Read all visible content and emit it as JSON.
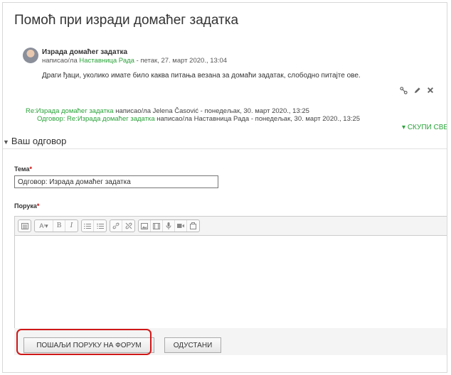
{
  "page": {
    "title": "Помоћ при изради домаћег задатка"
  },
  "post": {
    "subject": "Израда домаћег задатка",
    "by_prefix": "написао/ла ",
    "author": "Наставница Рада",
    "by_suffix": " - петак, 27. март 2020., 13:04",
    "body": "Драги ђаци, уколико имате било каква питања везана за домаћи задатак, слободно питајте ове.",
    "actions": [
      "permalink-icon",
      "edit-icon",
      "delete-icon"
    ]
  },
  "thread": [
    {
      "link": "Re:Израда домаћег задатка",
      "text": " написао/ла Jelena Časović - понедељак, 30. март 2020., 13:25"
    },
    {
      "link": "Одговор: Re:Израда домаћег задатка",
      "text": " написао/ла Наставница Рада - понедељак, 30. март 2020., 13:25"
    }
  ],
  "collapse_all": "СКУПИ СВЕ",
  "form": {
    "section_title": "Ваш одговор",
    "subject_label": "Тема",
    "subject_value": "Одговор: Израда домаћег задатка",
    "message_label": "Порука",
    "required_mark": "*",
    "toolbar": {
      "groups": [
        [
          "toolbar-toggle-icon"
        ],
        [
          "paragraph-style-icon",
          "bold-icon",
          "italic-icon"
        ],
        [
          "unordered-list-icon",
          "ordered-list-icon"
        ],
        [
          "link-icon",
          "unlink-icon"
        ],
        [
          "image-icon",
          "media-icon",
          "audio-record-icon",
          "video-record-icon",
          "manage-files-icon"
        ]
      ],
      "bold_glyph": "B",
      "italic_glyph": "I"
    },
    "post_button": "ПОШАЉИ ПОРУКУ НА ФОРУМ",
    "cancel_button": "ОДУСТАНИ"
  },
  "colors": {
    "link": "#2aa33a",
    "highlight": "#d01818",
    "required": "#cc0000"
  }
}
